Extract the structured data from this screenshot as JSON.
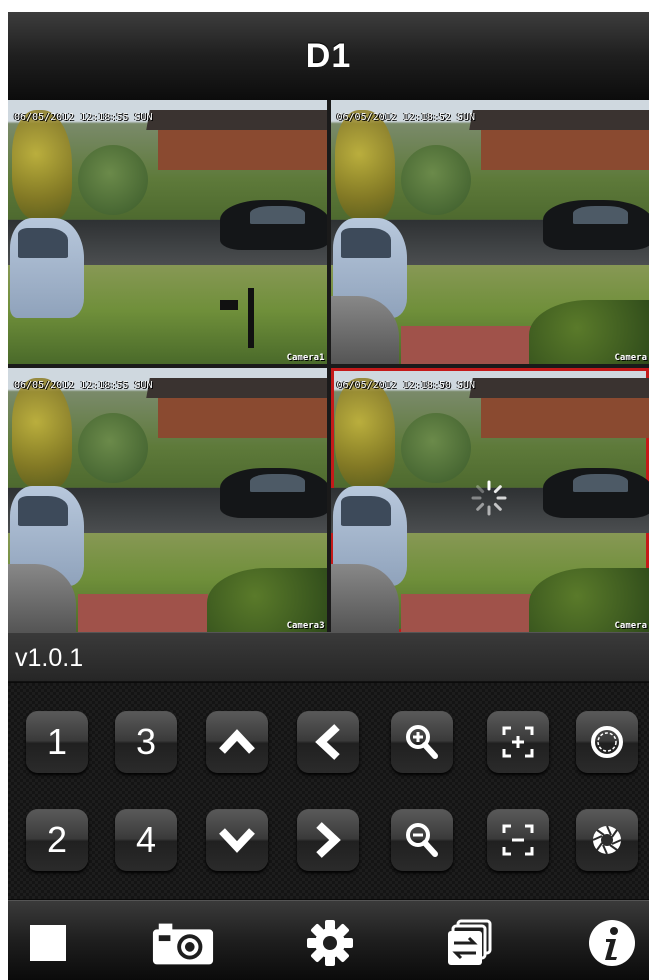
{
  "header": {
    "title": "D1"
  },
  "cameras": [
    {
      "timestamp": "06/05/2012 12:18:55 SUN",
      "label": "Camera1",
      "selected": false
    },
    {
      "timestamp": "06/05/2012 12:18:52 SUN",
      "label": "Camera",
      "selected": false
    },
    {
      "timestamp": "06/05/2012 12:18:55 SUN",
      "label": "Camera3",
      "selected": false
    },
    {
      "timestamp": "06/05/2012 12:18:50 SUN",
      "label": "Camera",
      "selected": true
    }
  ],
  "version": {
    "text": "v1.0.1"
  },
  "controls": {
    "channel_1": "1",
    "channel_2": "2",
    "channel_3": "3",
    "channel_4": "4",
    "icons": [
      "tilt-up-icon",
      "tilt-down-icon",
      "pan-left-icon",
      "pan-right-icon",
      "zoom-in-icon",
      "zoom-out-icon",
      "focus-near-icon",
      "focus-far-icon",
      "iris-open-icon",
      "iris-close-icon"
    ]
  },
  "tabbar": {
    "icons": [
      "stop-icon",
      "camera-snapshot-icon",
      "settings-gear-icon",
      "switch-view-icon",
      "info-icon"
    ]
  },
  "colors": {
    "selected_border": "#c41a1a",
    "bar_dark": "#1f1f1f",
    "text": "#ffffff"
  }
}
